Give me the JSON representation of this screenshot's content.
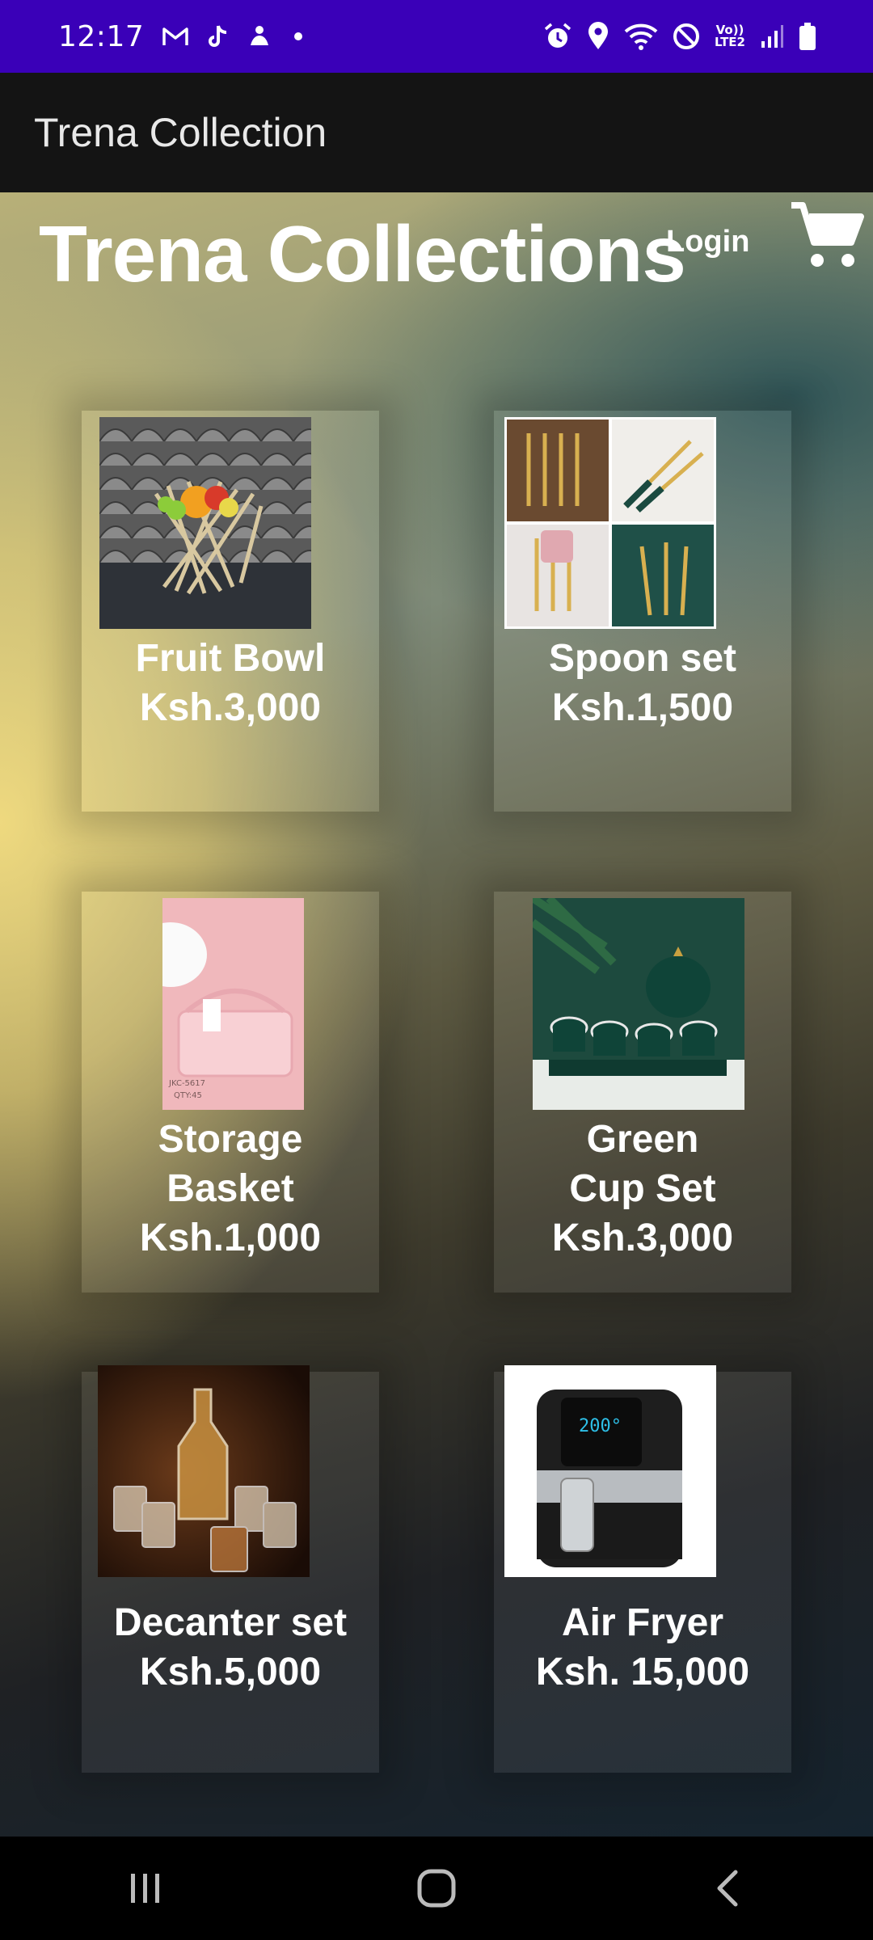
{
  "status_bar": {
    "time": "12:17",
    "left_icons": [
      "gmail-icon",
      "tiktok-icon",
      "app-notification-icon"
    ],
    "right_icons": [
      "alarm-icon",
      "location-icon",
      "wifi-icon",
      "do-not-disturb-icon",
      "volte-icon",
      "signal-icon",
      "battery-icon"
    ],
    "volte_top": "Vo))",
    "volte_bottom": "LTE2"
  },
  "app_bar": {
    "title": "Trena Collection"
  },
  "header": {
    "brand": "Trena Collections",
    "login": "Login",
    "cart_icon": "shopping-cart-icon"
  },
  "products": [
    {
      "name": "Fruit Bowl",
      "price": "Ksh.3,000"
    },
    {
      "name": "Spoon set",
      "price": "Ksh.1,500"
    },
    {
      "name": "Storage Basket",
      "price": "Ksh.1,000"
    },
    {
      "name": "Green Cup Set",
      "price": "Ksh.3,000"
    },
    {
      "name": "Decanter set",
      "price": "Ksh.5,000"
    },
    {
      "name": "Air Fryer",
      "price": "Ksh. 15,000"
    }
  ],
  "product_image_labels": {
    "basket_tag_1": "JKC-5617",
    "basket_tag_2": "QTY:45"
  },
  "air_fryer_display": "200°",
  "nav_bar": {
    "buttons": [
      "recent-apps-icon",
      "home-icon",
      "back-icon"
    ]
  },
  "colors": {
    "status_bar": "#3A00B8",
    "app_bar": "#141414",
    "accent_text": "#ffffff"
  }
}
